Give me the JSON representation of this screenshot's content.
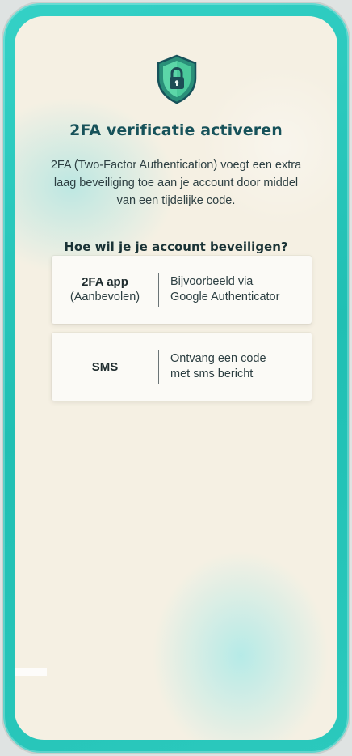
{
  "header": {
    "icon": "shield-lock-icon",
    "title": "2FA verificatie activeren",
    "description": "2FA (Two-Factor Authentication) voegt een extra laag beveiliging toe aan je account door middel van een tijdelijke code."
  },
  "question": "Hoe wil je je account beveiligen?",
  "options": [
    {
      "name": "2FA app",
      "subtitle": "(Aanbevolen)",
      "description_line1": "Bijvoorbeeld via",
      "description_line2": "Google Authenticator"
    },
    {
      "name": "SMS",
      "subtitle": "",
      "description_line1": "Ontvang een code",
      "description_line2": "met sms bericht"
    }
  ],
  "colors": {
    "accent": "#2bc9bd",
    "title": "#17525a",
    "shield": "#2a8f79",
    "background": "#f5f0e3"
  }
}
